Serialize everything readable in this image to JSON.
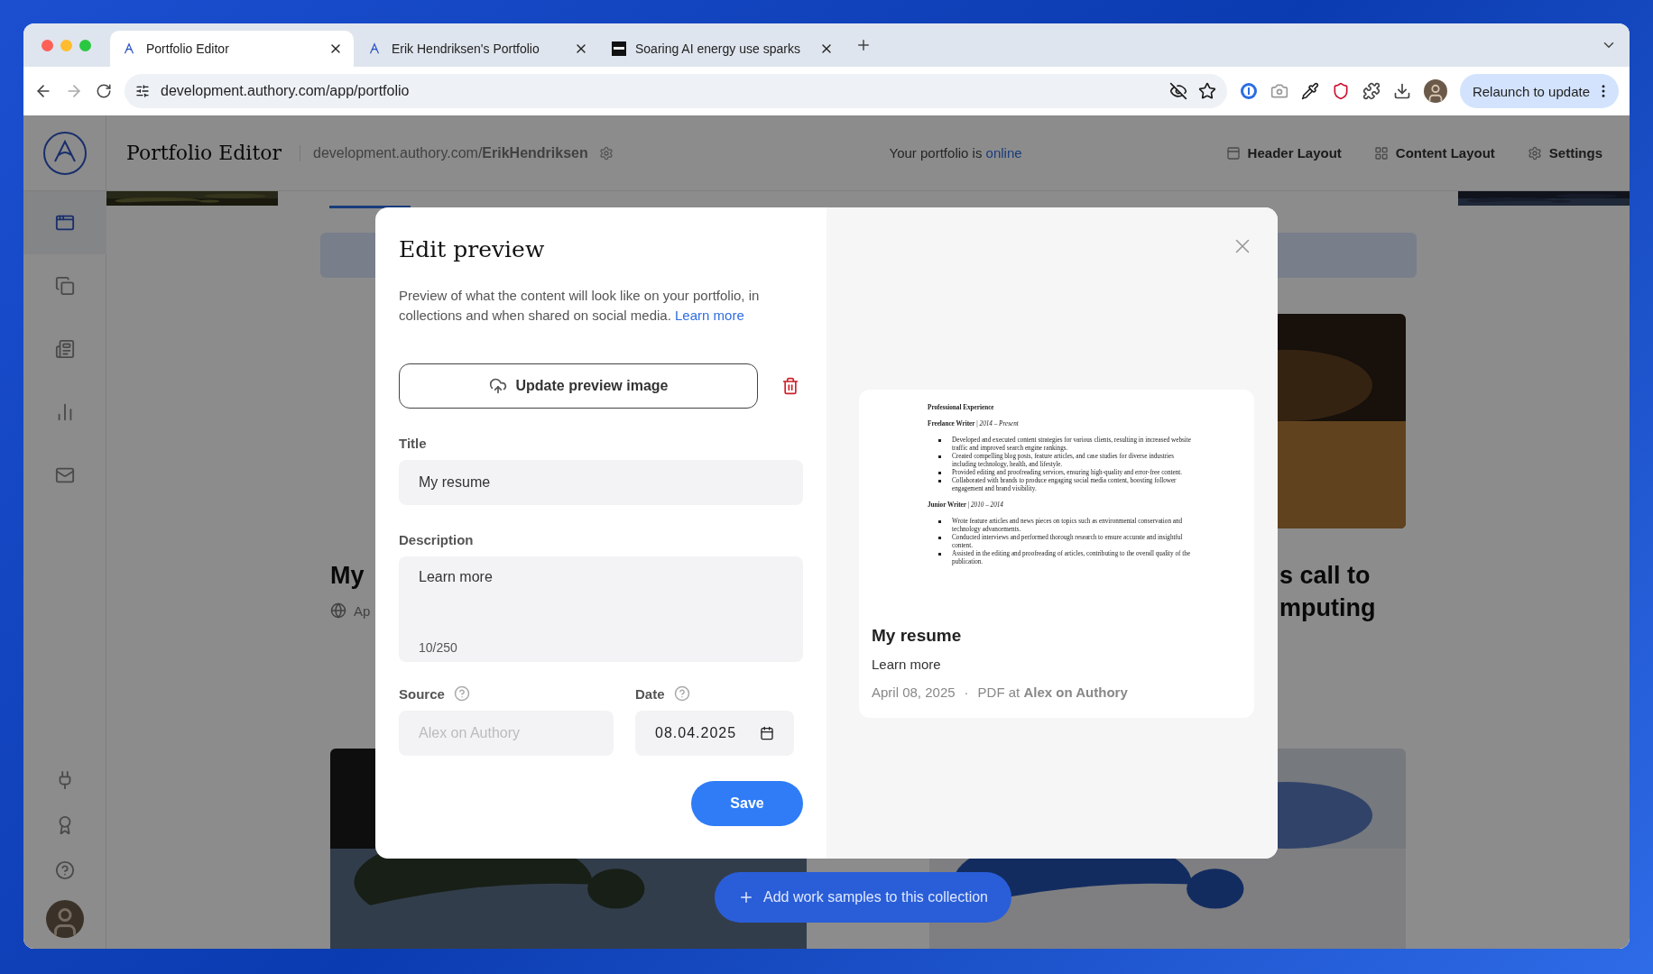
{
  "browser": {
    "tabs": [
      {
        "title": "Portfolio Editor",
        "kind": "authory",
        "selected": true
      },
      {
        "title": "Erik Hendriksen's Portfolio",
        "kind": "authory",
        "selected": false
      },
      {
        "title": "Soaring AI energy use sparks",
        "kind": "news",
        "selected": false
      }
    ],
    "url": "development.authory.com/app/portfolio",
    "relaunch_button": "Relaunch to update"
  },
  "app_header": {
    "title": "Portfolio Editor",
    "portfolio_url": "development.authory.com/**ErikHendriksen**",
    "status_text": "Your portfolio is",
    "status_link": "online",
    "actions": [
      {
        "label": "Header Layout",
        "kind": "header"
      },
      {
        "label": "Content Layout",
        "kind": "content"
      },
      {
        "label": "Settings",
        "kind": "settings"
      }
    ]
  },
  "sidebar": {
    "items": [
      {
        "kind": "portfolio",
        "selected": true
      },
      {
        "kind": "collections",
        "selected": false
      },
      {
        "kind": "articles",
        "selected": false
      },
      {
        "kind": "stats",
        "selected": false
      },
      {
        "kind": "mail",
        "selected": false
      }
    ],
    "bottom_items": [
      {
        "kind": "plug"
      },
      {
        "kind": "award"
      },
      {
        "kind": "help"
      }
    ]
  },
  "background": {
    "cards": [
      {
        "title": "My",
        "meta": "Ap"
      },
      {
        "title_lines": [
          "s call to",
          "mputing"
        ]
      }
    ],
    "add_button": "Add work samples to this collection"
  },
  "modal": {
    "title": "Edit preview",
    "description": "Preview of what the content will look like on your portfolio, in collections and when shared on social media.",
    "description_link": "Learn more",
    "upload_button": "Update preview image",
    "title_field": {
      "label": "Title",
      "value": "My resume"
    },
    "description_field": {
      "label": "Description",
      "value": "Learn more",
      "counter": "10/250"
    },
    "source_field": {
      "label": "Source",
      "placeholder": "Alex on Authory"
    },
    "date_field": {
      "label": "Date",
      "value": "08.04.2025"
    },
    "save_button": "Save",
    "preview": {
      "document": {
        "heading": "Professional Experience",
        "jobs": [
          {
            "title": "**Freelance Writer** | *2014 – Present*",
            "bullets": [
              "Developed and executed content strategies for various clients, resulting in increased website traffic and improved search engine rankings.",
              "Created compelling blog posts, feature articles, and case studies for diverse industries including technology, health, and lifestyle.",
              "Provided editing and proofreading services, ensuring high-quality and error-free content.",
              "Collaborated with brands to produce engaging social media content, boosting follower engagement and brand visibility."
            ]
          },
          {
            "title": "**Junior Writer** | *2010 – 2014*",
            "bullets": [
              "Wrote feature articles and news pieces on topics such as environmental conservation and technology advancements.",
              "Conducted interviews and performed thorough research to ensure accurate and insightful content.",
              "Assisted in the editing and proofreading of articles, contributing to the overall quality of the publication."
            ]
          }
        ]
      },
      "title": "My resume",
      "description": "Learn more",
      "date": "April 08, 2025",
      "separator": "·",
      "source": "PDF at **Alex on Authory**"
    }
  }
}
